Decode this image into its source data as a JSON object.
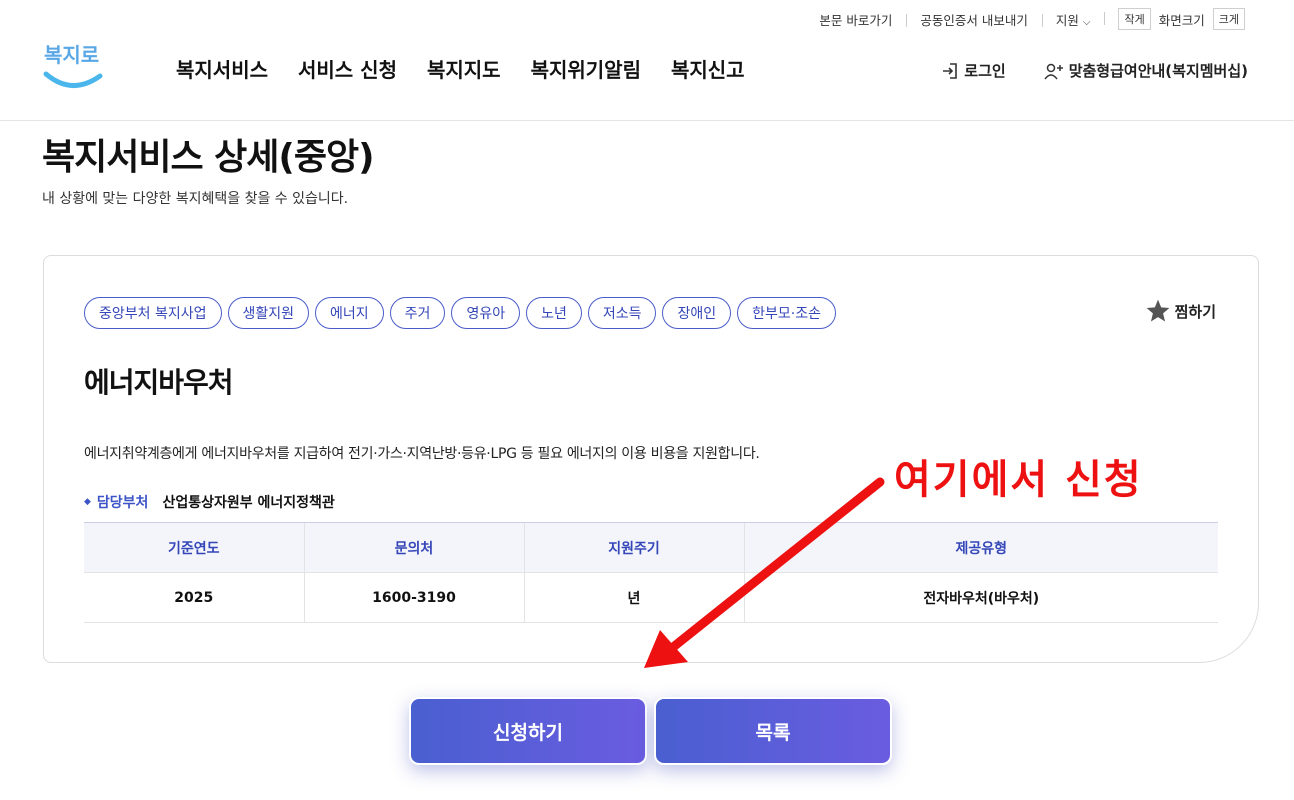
{
  "utility": {
    "skip_link": "본문 바로가기",
    "cert_export": "공동인증서 내보내기",
    "support": "지원",
    "font_small": "작게",
    "font_label": "화면크기",
    "font_large": "크게"
  },
  "logo": {
    "text": "복지로"
  },
  "gnb": [
    "복지서비스",
    "서비스 신청",
    "복지지도",
    "복지위기알림",
    "복지신고"
  ],
  "header_right": {
    "login": "로그인",
    "membership": "맞춤형급여안내(복지멤버십)"
  },
  "page": {
    "title": "복지서비스 상세(중앙)",
    "subtitle": "내 상황에 맞는 다양한 복지혜택을 찾을 수 있습니다."
  },
  "service": {
    "tags": [
      "중앙부처 복지사업",
      "생활지원",
      "에너지",
      "주거",
      "영유아",
      "노년",
      "저소득",
      "장애인",
      "한부모·조손"
    ],
    "favorite": "찜하기",
    "title": "에너지바우처",
    "description": "에너지취약계층에게 에너지바우처를 지급하여 전기·가스·지역난방·등유·LPG 등 필요 에너지의 이용 비용을 지원합니다.",
    "dept_label": "담당부처",
    "dept_value": "산업통상자원부 에너지정책관",
    "table": {
      "headers": [
        "기준연도",
        "문의처",
        "지원주기",
        "제공유형"
      ],
      "row": [
        "2025",
        "1600-3190",
        "년",
        "전자바우처(바우처)"
      ]
    }
  },
  "buttons": {
    "apply": "신청하기",
    "list": "목록"
  },
  "annotation": {
    "text": "여기에서 신청",
    "color": "#ee1111"
  },
  "colors": {
    "accent": "#3d54c7",
    "button_start": "#4a5fd0",
    "button_end": "#6a5ce0"
  }
}
